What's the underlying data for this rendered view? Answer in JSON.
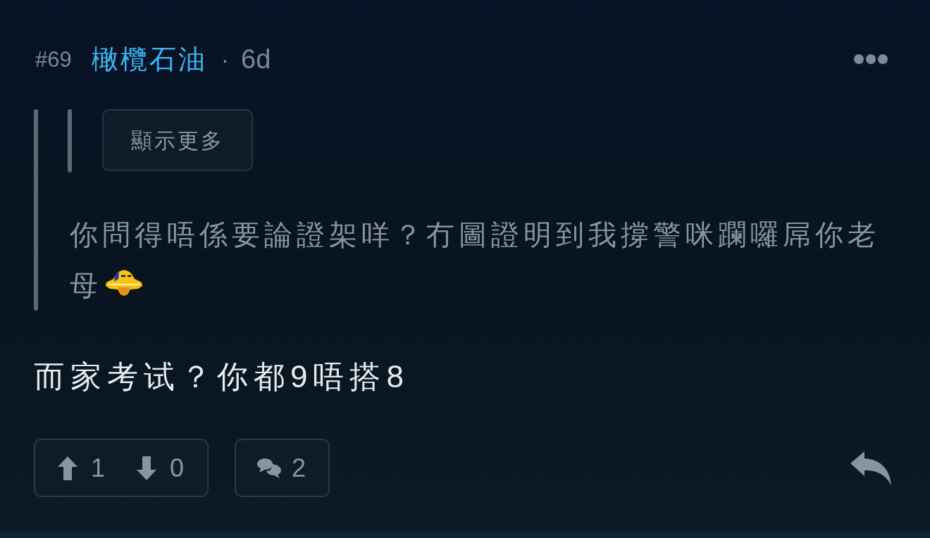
{
  "post": {
    "number": "#69",
    "author": "橄欖石油",
    "separator": "·",
    "age": "6d"
  },
  "quote": {
    "nested_quote": {
      "show_more_label": "顯示更多"
    },
    "content": [
      {
        "kind": "text",
        "text": "你問得唔係要論證架咩？冇圖證明到我撐警咪躝囉屌你老"
      },
      {
        "kind": "text",
        "text": "母"
      },
      {
        "kind": "emoji"
      }
    ]
  },
  "body": "而家考试？你都9唔搭8",
  "actions": {
    "upvotes": "1",
    "downvotes": "0",
    "comments": "2"
  }
}
